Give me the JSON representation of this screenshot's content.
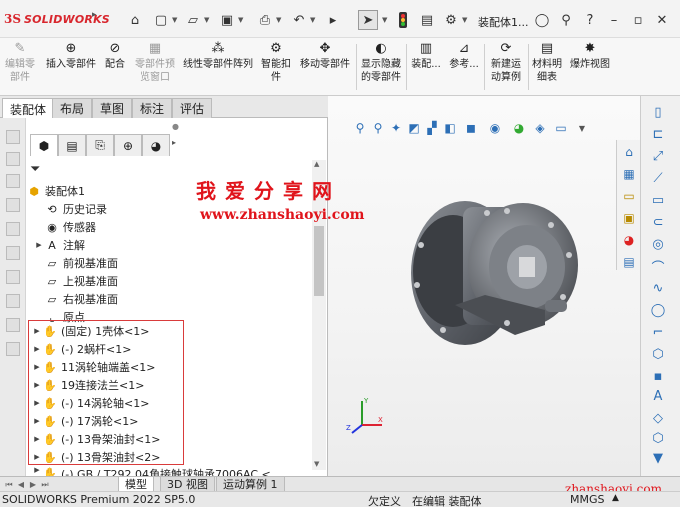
{
  "titlebar": {
    "brand": "SOLIDWORKS",
    "brand_prefix": "3S",
    "title": "装配体1...",
    "icons": [
      "home-icon",
      "new-icon",
      "open-icon",
      "save-icon",
      "print-icon",
      "undo-icon",
      "select-icon",
      "traffic-light-icon",
      "gear-icon",
      "search-icon",
      "user-icon",
      "help-icon"
    ]
  },
  "ribbon": {
    "items": [
      {
        "id": "edit-component",
        "label": "编辑零\n部件",
        "disabled": true
      },
      {
        "id": "insert-component",
        "label": "插入零部件",
        "disabled": false
      },
      {
        "id": "mate",
        "label": "配合",
        "disabled": false
      },
      {
        "id": "component-preview",
        "label": "零部件预\n览窗口",
        "disabled": true
      },
      {
        "id": "linear-pattern",
        "label": "线性零部件阵列",
        "disabled": false
      },
      {
        "id": "smart-fasteners",
        "label": "智能扣\n件",
        "disabled": false
      },
      {
        "id": "move-component",
        "label": "移动零部件",
        "disabled": false
      },
      {
        "id": "show-hidden",
        "label": "显示隐藏\n的零部件",
        "disabled": false
      },
      {
        "id": "assembly-features",
        "label": "装配...",
        "disabled": false
      },
      {
        "id": "reference",
        "label": "参考...",
        "disabled": false
      },
      {
        "id": "new-motion-study",
        "label": "新建运\n动算例",
        "disabled": false
      },
      {
        "id": "bom",
        "label": "材料明\n细表",
        "disabled": false
      },
      {
        "id": "exploded-view",
        "label": "爆炸视图",
        "disabled": false
      }
    ]
  },
  "tabs": [
    "装配体",
    "布局",
    "草图",
    "标注",
    "评估"
  ],
  "tree": {
    "root": "装配体1",
    "items": [
      {
        "label": "历史记录",
        "icon": "history-icon",
        "arrow": false
      },
      {
        "label": "传感器",
        "icon": "sensor-icon",
        "arrow": false
      },
      {
        "label": "注解",
        "icon": "annotation-icon",
        "arrow": true
      },
      {
        "label": "前视基准面",
        "icon": "plane-icon",
        "arrow": false
      },
      {
        "label": "上视基准面",
        "icon": "plane-icon",
        "arrow": false
      },
      {
        "label": "右视基准面",
        "icon": "plane-icon",
        "arrow": false
      },
      {
        "label": "原点",
        "icon": "origin-icon",
        "arrow": false
      }
    ],
    "components": [
      "(固定) 1壳体<1>",
      "(-) 2蜗杆<1>",
      "11涡轮轴端盖<1>",
      "19连接法兰<1>",
      "(-) 14涡轮轴<1>",
      "(-) 17涡轮<1>",
      "(-) 13骨架油封<1>",
      "(-) 13骨架油封<2>"
    ],
    "partial_item": "(-) GB / T292 04角接触球轴承7006AC <"
  },
  "watermark": {
    "line1": "我爱分享网",
    "line2": "www.zhanshaoyi.com",
    "footer": "zhanshaoyi.com"
  },
  "bottom_tabs": [
    "模型",
    "3D 视图",
    "运动算例 1"
  ],
  "status": {
    "app": "SOLIDWORKS Premium 2022 SP5.0",
    "def": "欠定义",
    "editing": "在编辑 装配体",
    "units": "MMGS"
  },
  "colors": {
    "accent": "#d8262d",
    "watermark": "#e0141b",
    "selection_box": "#d93b3b",
    "part": "#6a6e75"
  }
}
